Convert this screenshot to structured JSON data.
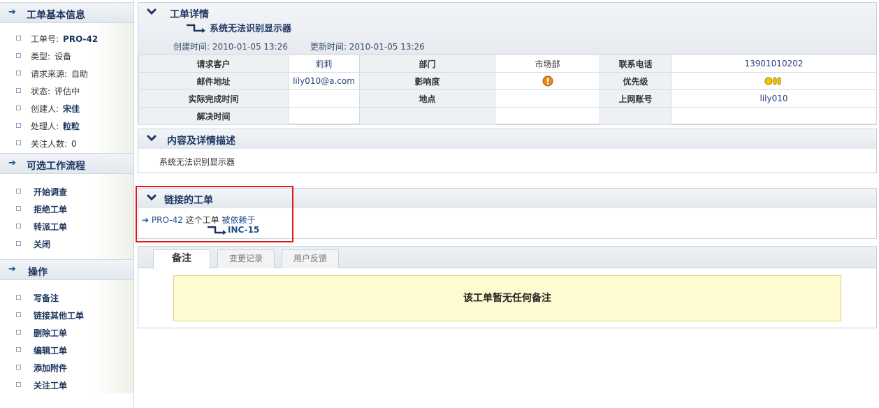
{
  "sidebar": {
    "basic_info": {
      "title": "工单基本信息",
      "items": [
        {
          "label": "工单号:",
          "value": "PRO-42"
        },
        {
          "label": "类型:",
          "value": "设备"
        },
        {
          "label": "请求来源:",
          "value": "自助"
        },
        {
          "label": "状态:",
          "value": "评估中"
        },
        {
          "label": "创建人:",
          "value": "宋佳"
        },
        {
          "label": "处理人:",
          "value": "粒粒"
        },
        {
          "label": "关注人数:",
          "value": "0"
        }
      ]
    },
    "workflow": {
      "title": "可选工作流程",
      "items": [
        "开始调查",
        "拒绝工单",
        "转派工单",
        "关闭"
      ]
    },
    "operations": {
      "title": "操作",
      "items": [
        "写备注",
        "链接其他工单",
        "删除工单",
        "编辑工单",
        "添加附件",
        "关注工单"
      ]
    }
  },
  "detail": {
    "title": "工单详情",
    "summary": "系统无法识别显示器",
    "created": "创建时间: 2010-01-05 13:26",
    "updated": "更新时间: 2010-01-05 13:26",
    "rows": [
      {
        "l1": "请求客户",
        "v1": "莉莉",
        "l2": "部门",
        "v2": "市场部",
        "l3": "联系电话",
        "v3": "13901010202"
      },
      {
        "l1": "邮件地址",
        "v1": "lily010@a.com",
        "l2": "影响度",
        "v2": "",
        "l3": "优先级",
        "v3": ""
      },
      {
        "l1": "实际完成时间",
        "v1": "",
        "l2": "地点",
        "v2": "",
        "l3": "上网账号",
        "v3": "lily010"
      },
      {
        "l1": "解决时间",
        "v1": "",
        "l2": "",
        "v2": "",
        "l3": "",
        "v3": ""
      }
    ],
    "impact_icon": "warning-icon",
    "priority_icon": "priority-dots-icon",
    "colors": {
      "impact": "#e8881a",
      "priority": "#f0c800",
      "accent": "#1d3660"
    }
  },
  "content": {
    "title": "内容及详情描述",
    "text": "系统无法识别显示器"
  },
  "linked": {
    "title": "链接的工单",
    "source": "PRO-42",
    "relation_pre": "这个工单",
    "relation": "被依赖于",
    "target": "INC-15",
    "highlight_color": "#e0161b"
  },
  "notes": {
    "tabs": [
      "备注",
      "变更记录",
      "用户反馈"
    ],
    "active_tab": "备注",
    "empty_message": "该工单暂无任何备注",
    "empty_bg": "#fdfbcf"
  }
}
